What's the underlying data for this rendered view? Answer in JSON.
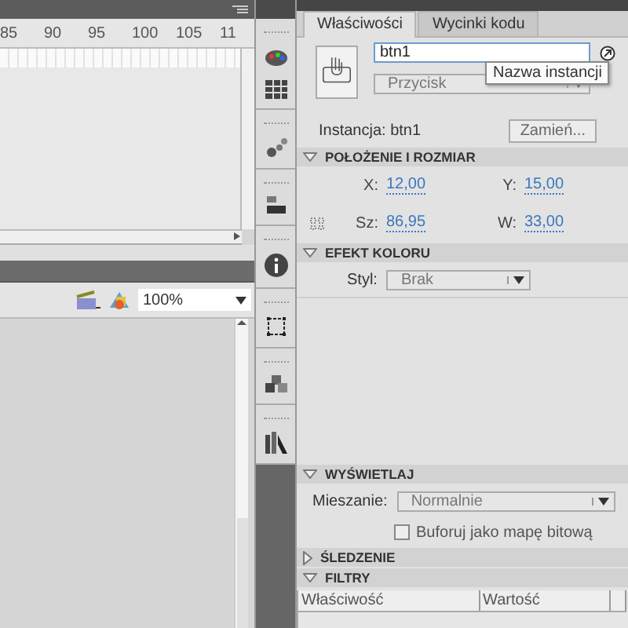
{
  "timeline": {
    "ruler": [
      "85",
      "90",
      "95",
      "100",
      "105",
      "11"
    ]
  },
  "stage_toolbar": {
    "zoom": "100%"
  },
  "properties": {
    "tabs": [
      {
        "label": "Właściwości",
        "selected": true
      },
      {
        "label": "Wycinki kodu",
        "selected": false
      }
    ],
    "instance_name": {
      "value": "btn1"
    },
    "tooltip": "Nazwa instancji",
    "symbol_type": "Przycisk",
    "instance_label": "Instancja:",
    "instance_value": "btn1",
    "swap_button": "Zamień...",
    "sections": [
      {
        "kind": "position",
        "title": "POŁOŻENIE I ROZMIAR",
        "expanded": true,
        "fields": [
          {
            "label": "X:",
            "value": "12,00"
          },
          {
            "label": "Y:",
            "value": "15,00"
          },
          {
            "label": "Sz:",
            "value": "86,95"
          },
          {
            "label": "W:",
            "value": "33,00"
          }
        ]
      },
      {
        "kind": "color",
        "title": "EFEKT KOLORU",
        "expanded": true,
        "label": "Styl:",
        "value": "Brak"
      },
      {
        "kind": "display",
        "title": "WYŚWIETLAJ",
        "expanded": true,
        "label": "Mieszanie:",
        "value": "Normalnie",
        "cache": {
          "label": "Buforuj jako mapę bitową",
          "checked": false
        }
      },
      {
        "title": "ŚLEDZENIE",
        "expanded": false
      },
      {
        "kind": "filters",
        "title": "FILTRY",
        "expanded": true,
        "columns": [
          "Właściwość",
          "Wartość"
        ]
      }
    ]
  }
}
